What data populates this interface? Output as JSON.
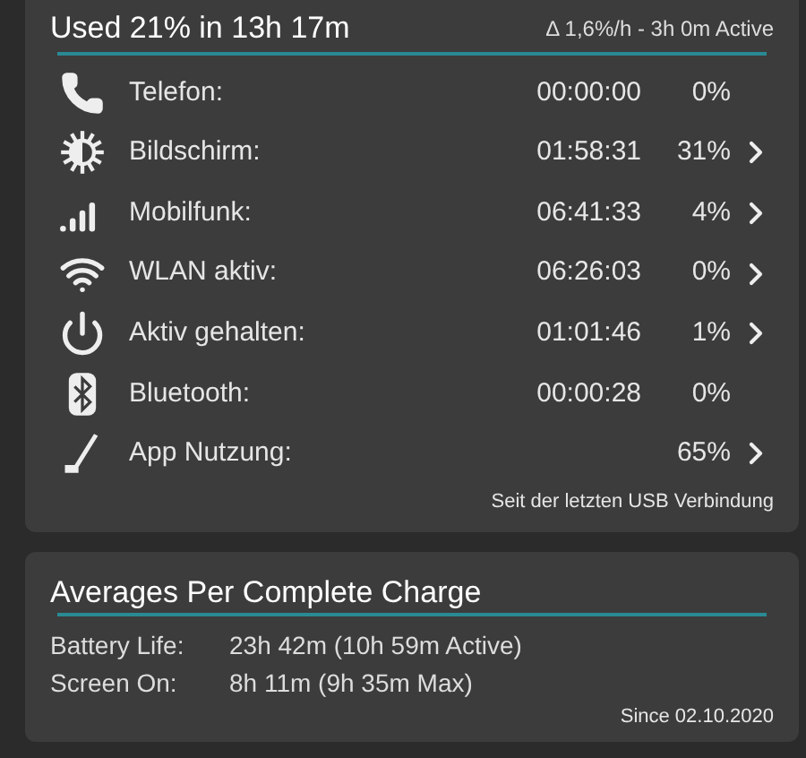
{
  "usage": {
    "title": "Used 21% in 13h 17m",
    "rate": "Δ 1,6%/h - 3h 0m Active",
    "rows": [
      {
        "kind": "phone",
        "label": "Telefon:",
        "time": "00:00:00",
        "percent": "0%",
        "expandable": false
      },
      {
        "kind": "screen",
        "label": "Bildschirm:",
        "time": "01:58:31",
        "percent": "31%",
        "expandable": true
      },
      {
        "kind": "signal",
        "label": "Mobilfunk:",
        "time": "06:41:33",
        "percent": "4%",
        "expandable": true
      },
      {
        "kind": "wifi",
        "label": "WLAN aktiv:",
        "time": "06:26:03",
        "percent": "0%",
        "expandable": true
      },
      {
        "kind": "power",
        "label": "Aktiv gehalten:",
        "time": "01:01:46",
        "percent": "1%",
        "expandable": true
      },
      {
        "kind": "bluetooth",
        "label": "Bluetooth:",
        "time": "00:00:28",
        "percent": "0%",
        "expandable": false
      },
      {
        "kind": "app",
        "label": "App Nutzung:",
        "percent": "65%",
        "expandable": true
      }
    ],
    "footnote": "Seit der letzten USB Verbindung"
  },
  "averages": {
    "title": "Averages Per Complete Charge",
    "rows": [
      {
        "label": "Battery Life:",
        "value": "23h 42m (10h 59m Active)"
      },
      {
        "label": "Screen On:",
        "value": "8h 11m (9h 35m Max)"
      }
    ],
    "footnote": "Since 02.10.2020"
  }
}
